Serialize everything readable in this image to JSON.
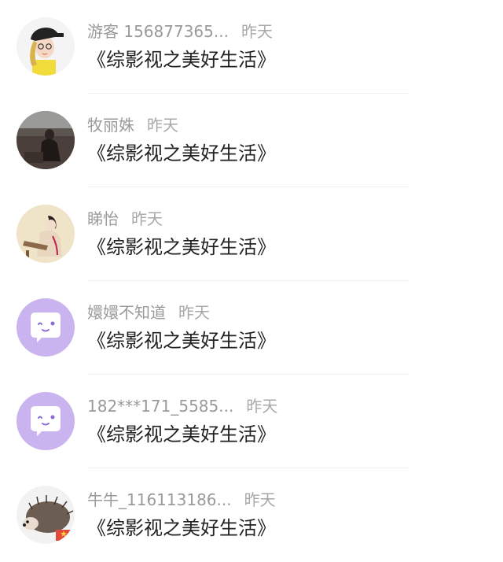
{
  "comments": [
    {
      "username": "游客 156877365...",
      "time": "昨天",
      "text": "《综影视之美好生活》",
      "avatar": "cartoon-girl-avatar"
    },
    {
      "username": "牧丽姝",
      "time": "昨天",
      "text": "《综影视之美好生活》",
      "avatar": "photo-avatar"
    },
    {
      "username": "睇怡",
      "time": "昨天",
      "text": "《综影视之美好生活》",
      "avatar": "painting-avatar"
    },
    {
      "username": "嬛嬛不知道",
      "time": "昨天",
      "text": "《综影视之美好生活》",
      "avatar": "default-chat-avatar"
    },
    {
      "username": "182***171_5585...",
      "time": "昨天",
      "text": "《综影视之美好生活》",
      "avatar": "default-chat-avatar"
    },
    {
      "username": "牛牛_116113186...",
      "time": "昨天",
      "text": "《综影视之美好生活》",
      "avatar": "hedgehog-avatar"
    }
  ],
  "colors": {
    "default_avatar_bg": "#c9b4f0",
    "meta_text": "#9a9a9a",
    "message_text": "#222222",
    "divider": "#efefef"
  }
}
